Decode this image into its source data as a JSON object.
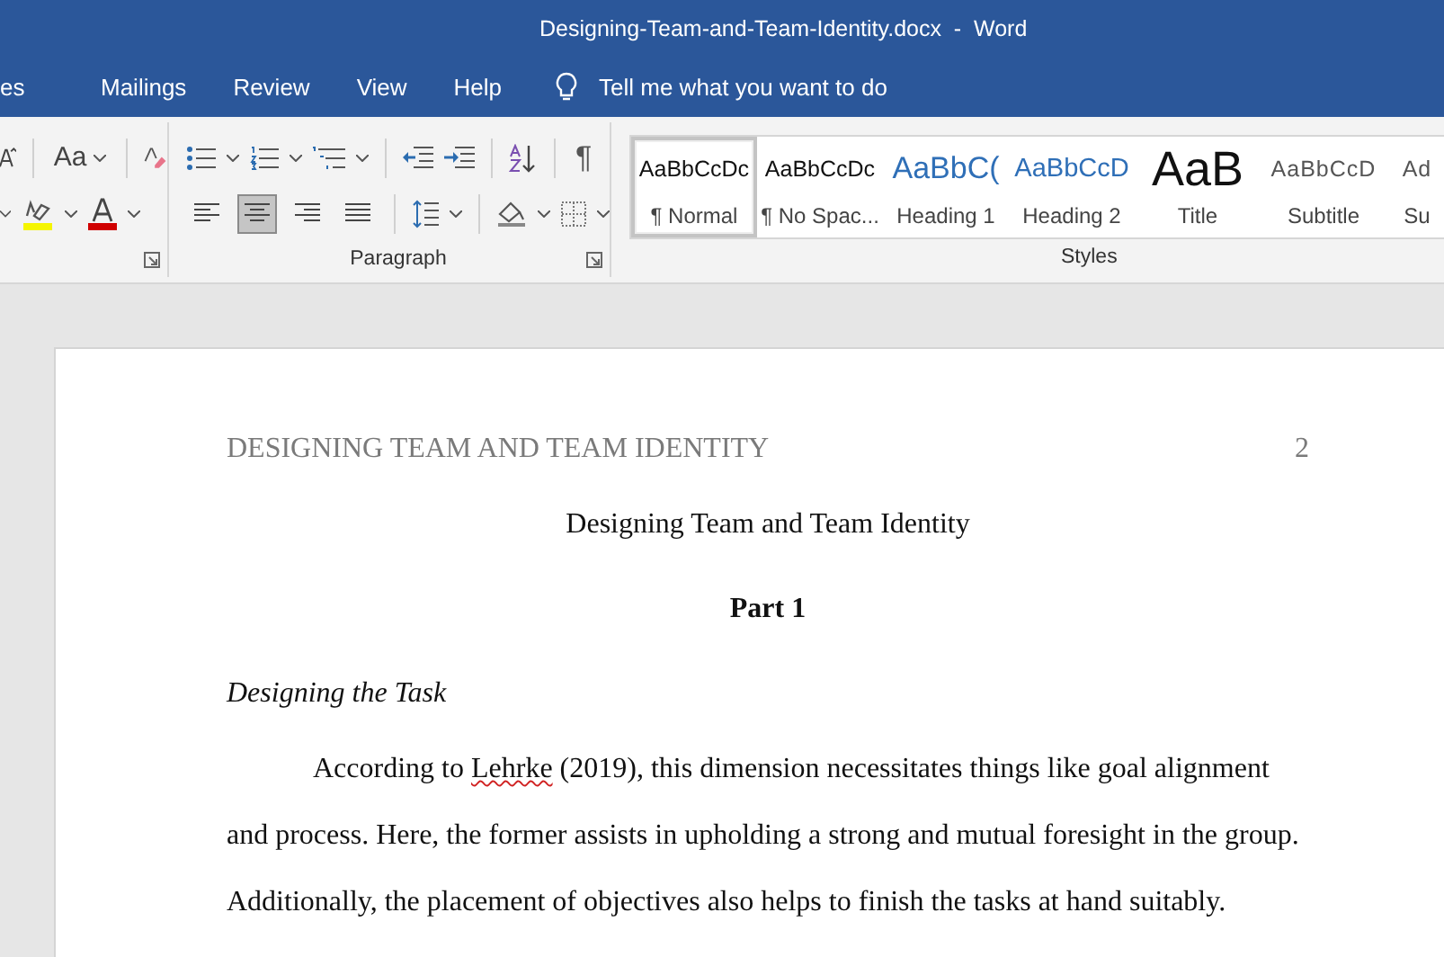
{
  "window": {
    "title": "Designing-Team-and-Team-Identity.docx  -  Word"
  },
  "tabs": [
    {
      "label": "es",
      "selected": false
    },
    {
      "label": "Mailings",
      "selected": false
    },
    {
      "label": "Review",
      "selected": false
    },
    {
      "label": "View",
      "selected": false
    },
    {
      "label": "Help",
      "selected": false
    }
  ],
  "tell_me": {
    "placeholder": "Tell me what you want to do"
  },
  "ribbon": {
    "font_group": {
      "change_case": "Aa"
    },
    "paragraph_group": {
      "label": "Paragraph",
      "show_marks": "¶",
      "alignments": [
        {
          "kind": "left",
          "selected": false
        },
        {
          "kind": "center",
          "selected": true
        },
        {
          "kind": "right",
          "selected": false
        },
        {
          "kind": "justify",
          "selected": false
        }
      ]
    },
    "styles_group": {
      "label": "Styles",
      "items": [
        {
          "kind": "normal",
          "sample": "AaBbCcDc",
          "name": "¶ Normal",
          "selected": true
        },
        {
          "kind": "normal",
          "sample": "AaBbCcDc",
          "name": "¶ No Spac...",
          "selected": false
        },
        {
          "kind": "heading1",
          "sample": "AaBbC(",
          "name": "Heading 1",
          "selected": false
        },
        {
          "kind": "heading2",
          "sample": "AaBbCcD",
          "name": "Heading 2",
          "selected": false
        },
        {
          "kind": "title",
          "sample": "AaB",
          "name": "Title",
          "selected": false
        },
        {
          "kind": "subtitle",
          "sample": "AaBbCcD",
          "name": "Subtitle",
          "selected": false
        },
        {
          "kind": "subtitle",
          "sample": "Ad",
          "name": "Su",
          "selected": false
        }
      ]
    }
  },
  "document": {
    "header": {
      "running_head": "DESIGNING TEAM AND TEAM IDENTITY",
      "page_number": "2"
    },
    "title": "Designing Team and Team Identity",
    "part_heading": "Part 1",
    "section_heading": "Designing the Task",
    "paragraph_lines": [
      {
        "indent": true,
        "segments": [
          {
            "text": "According to ",
            "misspelled": false
          },
          {
            "text": "Lehrke",
            "misspelled": true
          },
          {
            "text": " (2019), this dimension necessitates things like goal alignment",
            "misspelled": false
          }
        ]
      },
      {
        "indent": false,
        "segments": [
          {
            "text": "and process. Here, the former assists in upholding a strong and mutual foresight in the group.",
            "misspelled": false
          }
        ]
      },
      {
        "indent": false,
        "segments": [
          {
            "text": "Additionally, the placement of objectives also helps to finish the tasks at hand suitably.",
            "misspelled": false
          }
        ]
      }
    ]
  }
}
